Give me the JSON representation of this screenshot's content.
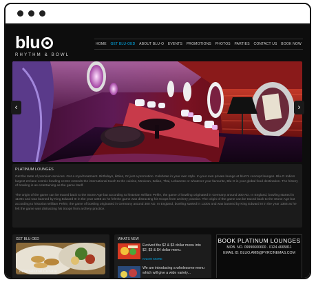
{
  "logo": {
    "text": "blu",
    "subtitle": "RHYTHM & BOWL"
  },
  "nav": {
    "items": [
      "HOME",
      "GET BLU-OED",
      "ABOUT BLU-O",
      "EVENTS",
      "PROMOTIONS",
      "PHOTOS",
      "PARTIES",
      "CONTACT US",
      "BOOK NOW"
    ],
    "active_index": 1
  },
  "slider": {
    "prev": "‹",
    "next": "›"
  },
  "content": {
    "heading": "PLATINUM LOUNGES",
    "paragraphs": [
      "Get the taste of premium services. Get a royal treatment. Birthdays, kitties, Or just a promotion. Celebrate in your own style. In your own private lounge at bluO's concept lounges. Blu-O India's largest 24 lane cosmic bowling centre extends the international touch to the cuisine, Mexican, Italian, Thai, Lebanese or whatever your favourite, Blu-O is your global food destination. The history of bowling is as entertaining as the game itself.",
      "The origin of the game can be traced back to the Stone Age but according to historian William Pehle, the game of bowling originated in Germany around 300 AD. In England, bowling started in 1100s and was banned by King Edward III in the year 1366 as he felt the game was distracting his troops from archery practice. The origin of the game can be traced back to the Stone Age but according to historian William Pehle, the game of bowling originated in Germany around 300 AD. In England, bowling started in 1100s and was banned by King Edward III in the year 1366 as he felt the game was distracting his troops from archery practice."
    ]
  },
  "boxes": {
    "get_bluoed": {
      "title": "GET BLU-OED",
      "caption": "International Cuisine"
    },
    "whats_new": {
      "title": "WHATS NEW",
      "items": [
        {
          "text": "Evolved the $2 & $3 dollar menu into $2, $3 & $4 dollar menu.",
          "more": "KNOW MORE"
        },
        {
          "text": "We are introducing a wholesome menu which will give a wide variety...",
          "more": ""
        }
      ]
    },
    "promo": {
      "title": "BOOK PLATINUM LOUNGES",
      "mobile": "MOB. NO. 09990600600 . 0124 4665811",
      "email": "EMAIL ID: BLUO.AMB@PVRCINEMAS.COM"
    }
  }
}
